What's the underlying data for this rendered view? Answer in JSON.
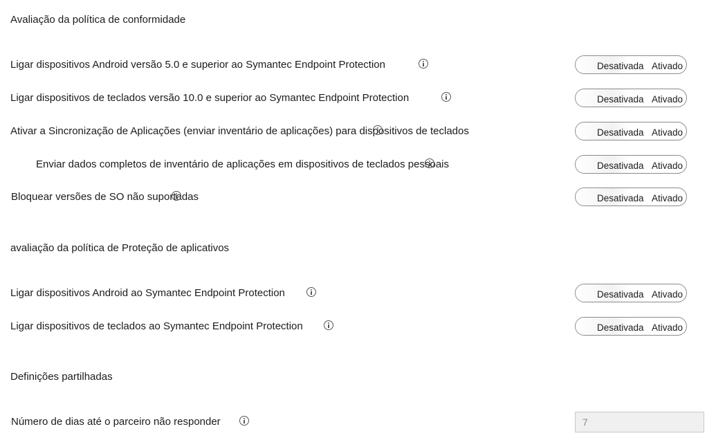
{
  "compliance_section": {
    "title": "Avaliação da política de conformidade",
    "rows": [
      {
        "label": "Ligar dispositivos Android versão 5.0 e superior ao Symantec Endpoint Protection",
        "off": "Desativada",
        "on": "Ativado"
      },
      {
        "label": "Ligar dispositivos de teclados versão 10.0 e superior ao Symantec Endpoint Protection",
        "off": "Desativada",
        "on": "Ativado"
      },
      {
        "label": "Ativar a Sincronização de Aplicações (enviar inventário de aplicações) para dispositivos de teclados",
        "off": "Desativada",
        "on": "Ativado"
      },
      {
        "label": "Enviar dados completos de inventário de aplicações em dispositivos de teclados pessoais",
        "off": "Desativada",
        "on": "Ativado"
      },
      {
        "label": "Bloquear versões de SO não suportadas",
        "off": "Desativada",
        "on": "Ativado"
      }
    ]
  },
  "app_protection_section": {
    "title": "avaliação da política de Proteção de aplicativos",
    "rows": [
      {
        "label": "Ligar dispositivos Android ao Symantec Endpoint Protection",
        "off": "Desativada",
        "on": "Ativado"
      },
      {
        "label": "Ligar dispositivos de teclados ao Symantec Endpoint Protection",
        "off": "Desativada",
        "on": "Ativado"
      }
    ]
  },
  "shared_section": {
    "title": "Definições partilhadas",
    "days_label": "Número de dias até o parceiro não responder",
    "days_value": "7"
  },
  "icons": {
    "info": "info-icon"
  }
}
